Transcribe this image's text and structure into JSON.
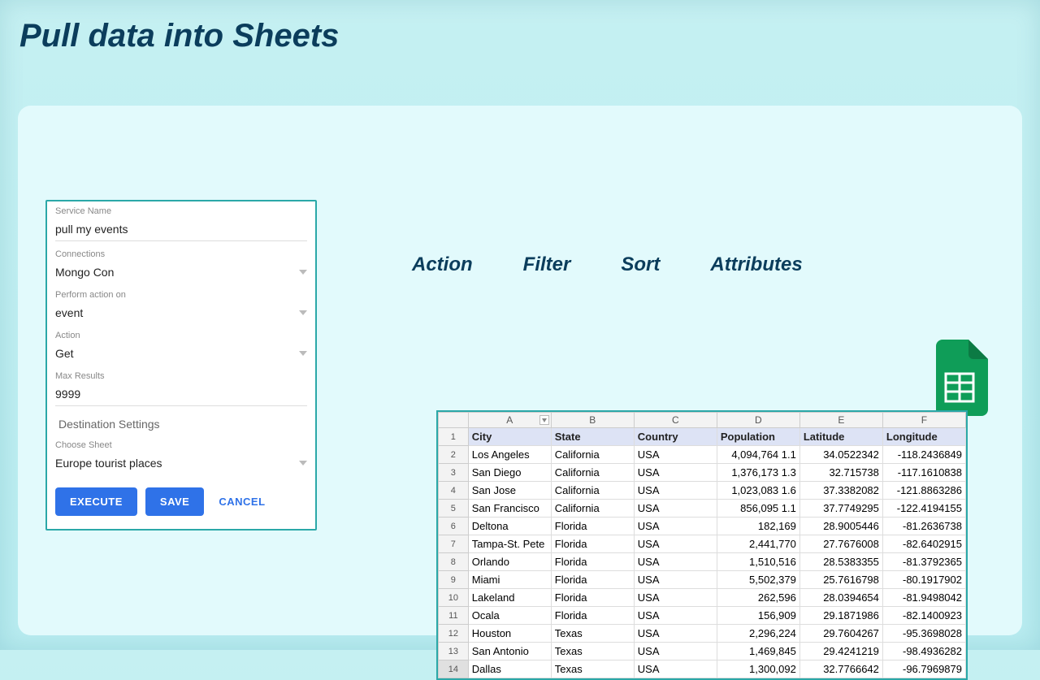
{
  "page_title": "Pull data into Sheets",
  "form": {
    "service_name_label": "Service Name",
    "service_name_value": "pull my events",
    "connections_label": "Connections",
    "connections_value": "Mongo Con",
    "perform_on_label": "Perform action on",
    "perform_on_value": "event",
    "action_label": "Action",
    "action_value": "Get",
    "max_results_label": "Max Results",
    "max_results_value": "9999",
    "destination_header": "Destination Settings",
    "choose_sheet_label": "Choose Sheet",
    "choose_sheet_value": "Europe tourist places",
    "execute_btn": "EXECUTE",
    "save_btn": "SAVE",
    "cancel_btn": "CANCEL"
  },
  "tabs": {
    "t1": "Action",
    "t2": "Filter",
    "t3": "Sort",
    "t4": "Attributes"
  },
  "spreadsheet": {
    "col_headers": [
      "A",
      "B",
      "C",
      "D",
      "E",
      "F"
    ],
    "header_row": [
      "City",
      "State",
      "Country",
      "Population",
      "Latitude",
      "Longitude"
    ],
    "rows": [
      {
        "n": "2",
        "city": "Los Angeles",
        "state": "California",
        "country": "USA",
        "pop": "4,094,764 1.1",
        "lat": "34.0522342",
        "lon": "-118.2436849"
      },
      {
        "n": "3",
        "city": "San Diego",
        "state": "California",
        "country": "USA",
        "pop": "1,376,173 1.3",
        "lat": "32.715738",
        "lon": "-117.1610838"
      },
      {
        "n": "4",
        "city": "San Jose",
        "state": "California",
        "country": "USA",
        "pop": "1,023,083 1.6",
        "lat": "37.3382082",
        "lon": "-121.8863286"
      },
      {
        "n": "5",
        "city": "San Francisco",
        "state": "California",
        "country": "USA",
        "pop": "856,095 1.1",
        "lat": "37.7749295",
        "lon": "-122.4194155"
      },
      {
        "n": "6",
        "city": "Deltona",
        "state": "Florida",
        "country": "USA",
        "pop": "182,169",
        "lat": "28.9005446",
        "lon": "-81.2636738"
      },
      {
        "n": "7",
        "city": "Tampa-St. Pete",
        "state": "Florida",
        "country": "USA",
        "pop": "2,441,770",
        "lat": "27.7676008",
        "lon": "-82.6402915"
      },
      {
        "n": "8",
        "city": "Orlando",
        "state": "Florida",
        "country": "USA",
        "pop": "1,510,516",
        "lat": "28.5383355",
        "lon": "-81.3792365"
      },
      {
        "n": "9",
        "city": "Miami",
        "state": "Florida",
        "country": "USA",
        "pop": "5,502,379",
        "lat": "25.7616798",
        "lon": "-80.1917902"
      },
      {
        "n": "10",
        "city": "Lakeland",
        "state": "Florida",
        "country": "USA",
        "pop": "262,596",
        "lat": "28.0394654",
        "lon": "-81.9498042"
      },
      {
        "n": "11",
        "city": "Ocala",
        "state": "Florida",
        "country": "USA",
        "pop": "156,909",
        "lat": "29.1871986",
        "lon": "-82.1400923"
      },
      {
        "n": "12",
        "city": "Houston",
        "state": "Texas",
        "country": "USA",
        "pop": "2,296,224",
        "lat": "29.7604267",
        "lon": "-95.3698028"
      },
      {
        "n": "13",
        "city": "San Antonio",
        "state": "Texas",
        "country": "USA",
        "pop": "1,469,845",
        "lat": "29.4241219",
        "lon": "-98.4936282"
      },
      {
        "n": "14",
        "city": "Dallas",
        "state": "Texas",
        "country": "USA",
        "pop": "1,300,092",
        "lat": "32.7766642",
        "lon": "-96.7969879"
      }
    ]
  }
}
